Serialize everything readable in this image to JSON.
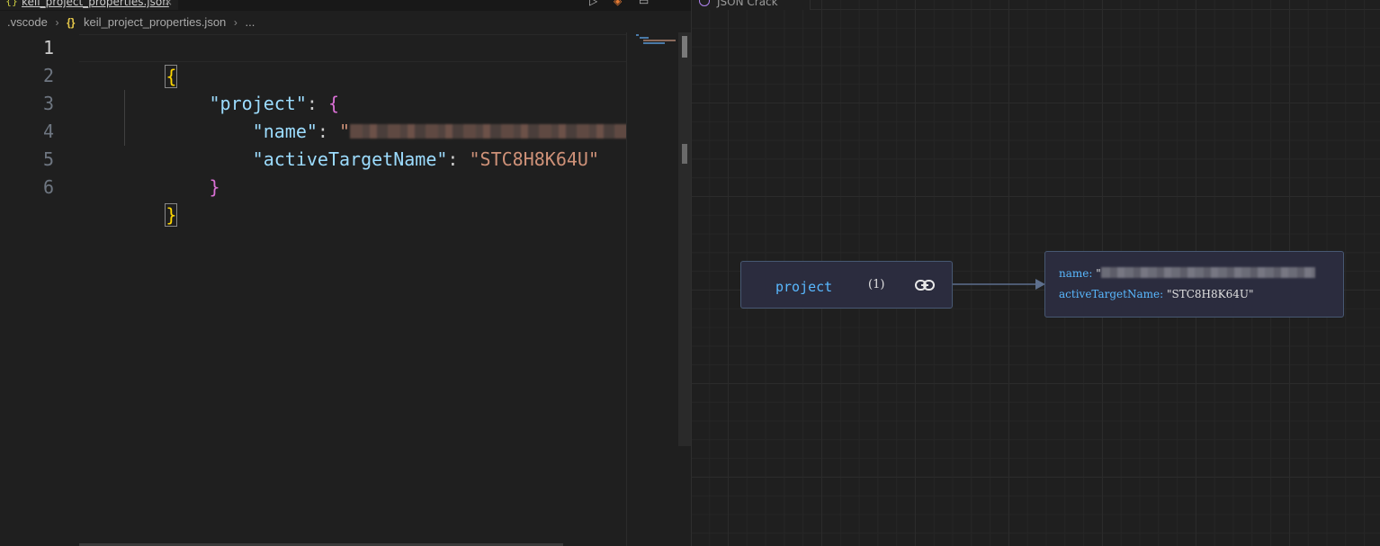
{
  "editor": {
    "tab": {
      "label": "keil_project_properties.json"
    },
    "breadcrumb": {
      "folder": ".vscode",
      "file": "keil_project_properties.json",
      "more": "..."
    },
    "lines": [
      {
        "num": "1"
      },
      {
        "num": "2",
        "key": "\"project\""
      },
      {
        "num": "3",
        "key": "\"name\""
      },
      {
        "num": "4",
        "key": "\"activeTargetName\"",
        "value": "\"STC8H8K64U\""
      },
      {
        "num": "5"
      },
      {
        "num": "6"
      }
    ],
    "syntax": {
      "open_brace": "{",
      "close_brace": "}",
      "colon": ": ",
      "name_value_prefix": "\""
    }
  },
  "crack": {
    "tab": {
      "label": "JSON Crack"
    },
    "root_node": {
      "label": "project",
      "count": "(1)",
      "icon": "link-icon"
    },
    "child_node": {
      "name_key": "name: ",
      "name_value_prefix": "\"",
      "target_key": "activeTargetName: ",
      "target_value": "\"STC8H8K64U\""
    }
  },
  "colors": {
    "json_key": "#9cdcfe",
    "json_string": "#ce9178",
    "brace_gold": "#ffd700",
    "brace_purple": "#da70d6",
    "node_key": "#59b8ff",
    "node_border": "#475872",
    "node_bg": "#2b2c3e"
  }
}
